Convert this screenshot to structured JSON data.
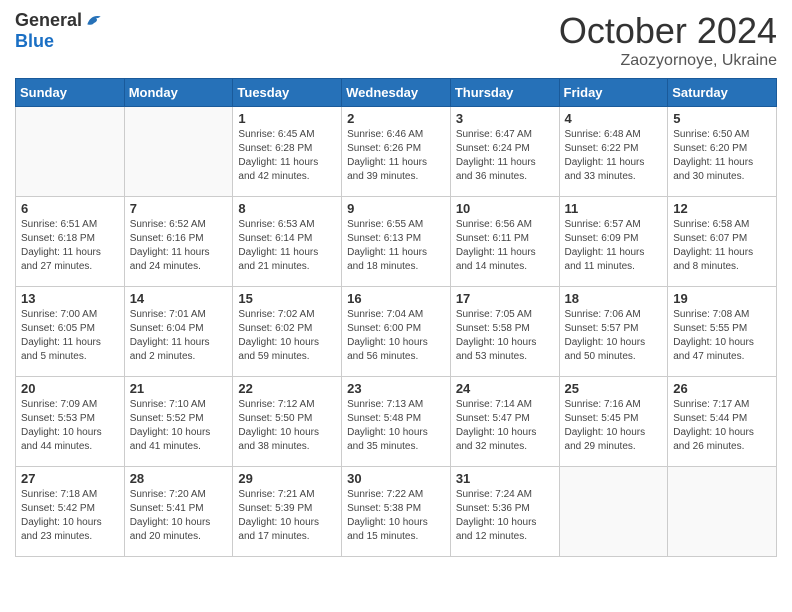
{
  "header": {
    "logo_general": "General",
    "logo_blue": "Blue",
    "month_title": "October 2024",
    "subtitle": "Zaozyornoye, Ukraine"
  },
  "weekdays": [
    "Sunday",
    "Monday",
    "Tuesday",
    "Wednesday",
    "Thursday",
    "Friday",
    "Saturday"
  ],
  "weeks": [
    [
      {
        "day": "",
        "info": ""
      },
      {
        "day": "",
        "info": ""
      },
      {
        "day": "1",
        "info": "Sunrise: 6:45 AM\nSunset: 6:28 PM\nDaylight: 11 hours and 42 minutes."
      },
      {
        "day": "2",
        "info": "Sunrise: 6:46 AM\nSunset: 6:26 PM\nDaylight: 11 hours and 39 minutes."
      },
      {
        "day": "3",
        "info": "Sunrise: 6:47 AM\nSunset: 6:24 PM\nDaylight: 11 hours and 36 minutes."
      },
      {
        "day": "4",
        "info": "Sunrise: 6:48 AM\nSunset: 6:22 PM\nDaylight: 11 hours and 33 minutes."
      },
      {
        "day": "5",
        "info": "Sunrise: 6:50 AM\nSunset: 6:20 PM\nDaylight: 11 hours and 30 minutes."
      }
    ],
    [
      {
        "day": "6",
        "info": "Sunrise: 6:51 AM\nSunset: 6:18 PM\nDaylight: 11 hours and 27 minutes."
      },
      {
        "day": "7",
        "info": "Sunrise: 6:52 AM\nSunset: 6:16 PM\nDaylight: 11 hours and 24 minutes."
      },
      {
        "day": "8",
        "info": "Sunrise: 6:53 AM\nSunset: 6:14 PM\nDaylight: 11 hours and 21 minutes."
      },
      {
        "day": "9",
        "info": "Sunrise: 6:55 AM\nSunset: 6:13 PM\nDaylight: 11 hours and 18 minutes."
      },
      {
        "day": "10",
        "info": "Sunrise: 6:56 AM\nSunset: 6:11 PM\nDaylight: 11 hours and 14 minutes."
      },
      {
        "day": "11",
        "info": "Sunrise: 6:57 AM\nSunset: 6:09 PM\nDaylight: 11 hours and 11 minutes."
      },
      {
        "day": "12",
        "info": "Sunrise: 6:58 AM\nSunset: 6:07 PM\nDaylight: 11 hours and 8 minutes."
      }
    ],
    [
      {
        "day": "13",
        "info": "Sunrise: 7:00 AM\nSunset: 6:05 PM\nDaylight: 11 hours and 5 minutes."
      },
      {
        "day": "14",
        "info": "Sunrise: 7:01 AM\nSunset: 6:04 PM\nDaylight: 11 hours and 2 minutes."
      },
      {
        "day": "15",
        "info": "Sunrise: 7:02 AM\nSunset: 6:02 PM\nDaylight: 10 hours and 59 minutes."
      },
      {
        "day": "16",
        "info": "Sunrise: 7:04 AM\nSunset: 6:00 PM\nDaylight: 10 hours and 56 minutes."
      },
      {
        "day": "17",
        "info": "Sunrise: 7:05 AM\nSunset: 5:58 PM\nDaylight: 10 hours and 53 minutes."
      },
      {
        "day": "18",
        "info": "Sunrise: 7:06 AM\nSunset: 5:57 PM\nDaylight: 10 hours and 50 minutes."
      },
      {
        "day": "19",
        "info": "Sunrise: 7:08 AM\nSunset: 5:55 PM\nDaylight: 10 hours and 47 minutes."
      }
    ],
    [
      {
        "day": "20",
        "info": "Sunrise: 7:09 AM\nSunset: 5:53 PM\nDaylight: 10 hours and 44 minutes."
      },
      {
        "day": "21",
        "info": "Sunrise: 7:10 AM\nSunset: 5:52 PM\nDaylight: 10 hours and 41 minutes."
      },
      {
        "day": "22",
        "info": "Sunrise: 7:12 AM\nSunset: 5:50 PM\nDaylight: 10 hours and 38 minutes."
      },
      {
        "day": "23",
        "info": "Sunrise: 7:13 AM\nSunset: 5:48 PM\nDaylight: 10 hours and 35 minutes."
      },
      {
        "day": "24",
        "info": "Sunrise: 7:14 AM\nSunset: 5:47 PM\nDaylight: 10 hours and 32 minutes."
      },
      {
        "day": "25",
        "info": "Sunrise: 7:16 AM\nSunset: 5:45 PM\nDaylight: 10 hours and 29 minutes."
      },
      {
        "day": "26",
        "info": "Sunrise: 7:17 AM\nSunset: 5:44 PM\nDaylight: 10 hours and 26 minutes."
      }
    ],
    [
      {
        "day": "27",
        "info": "Sunrise: 7:18 AM\nSunset: 5:42 PM\nDaylight: 10 hours and 23 minutes."
      },
      {
        "day": "28",
        "info": "Sunrise: 7:20 AM\nSunset: 5:41 PM\nDaylight: 10 hours and 20 minutes."
      },
      {
        "day": "29",
        "info": "Sunrise: 7:21 AM\nSunset: 5:39 PM\nDaylight: 10 hours and 17 minutes."
      },
      {
        "day": "30",
        "info": "Sunrise: 7:22 AM\nSunset: 5:38 PM\nDaylight: 10 hours and 15 minutes."
      },
      {
        "day": "31",
        "info": "Sunrise: 7:24 AM\nSunset: 5:36 PM\nDaylight: 10 hours and 12 minutes."
      },
      {
        "day": "",
        "info": ""
      },
      {
        "day": "",
        "info": ""
      }
    ]
  ]
}
